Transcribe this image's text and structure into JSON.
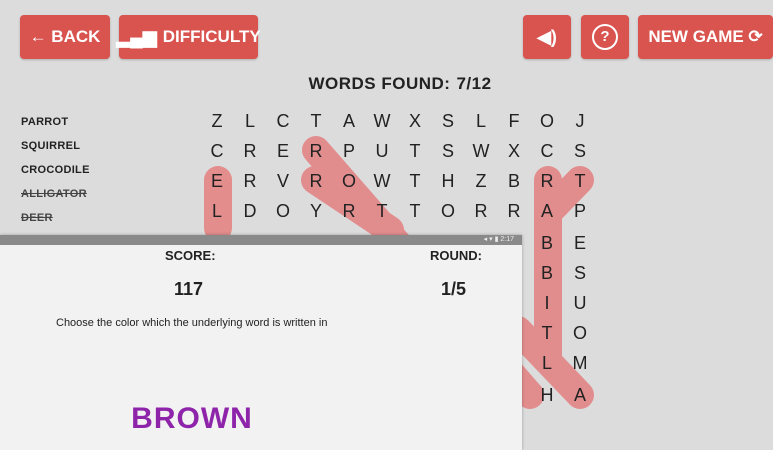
{
  "toolbar": {
    "back_label": "← BACK",
    "difficulty_label": "DIFFICULTY",
    "sound_icon": "speaker-icon",
    "help_icon": "help-circle-icon",
    "new_game_label": "NEW GAME ⟳"
  },
  "words_found": {
    "label": "WORDS FOUND:",
    "value": "7/12"
  },
  "word_list": [
    {
      "text": "PARROT",
      "found": false
    },
    {
      "text": "SQUIRREL",
      "found": false
    },
    {
      "text": "CROCODILE",
      "found": false
    },
    {
      "text": "ALLIGATOR",
      "found": true
    },
    {
      "text": "DEER",
      "found": true
    }
  ],
  "grid": {
    "rows": [
      [
        "Z",
        "L",
        "C",
        "T",
        "A",
        "W",
        "X",
        "S",
        "L",
        "F",
        "O",
        "J"
      ],
      [
        "C",
        "R",
        "E",
        "R",
        "P",
        "U",
        "T",
        "S",
        "W",
        "X",
        "C",
        "S"
      ],
      [
        "E",
        "R",
        "V",
        "R",
        "O",
        "W",
        "T",
        "H",
        "Z",
        "B",
        "R",
        "T"
      ],
      [
        "L",
        "D",
        "O",
        "Y",
        "R",
        "T",
        "T",
        "O",
        "R",
        "R",
        "A",
        "P"
      ],
      [
        "",
        "",
        "",
        "",
        "",
        "",
        "",
        "",
        "",
        "",
        "B",
        "E"
      ],
      [
        "",
        "",
        "",
        "",
        "",
        "",
        "",
        "",
        "",
        "",
        "B",
        "S"
      ],
      [
        "",
        "",
        "",
        "",
        "",
        "",
        "",
        "",
        "",
        "",
        "I",
        "U"
      ],
      [
        "",
        "",
        "",
        "",
        "",
        "",
        "",
        "",
        "",
        "",
        "T",
        "O"
      ],
      [
        "",
        "",
        "",
        "",
        "",
        "",
        "",
        "",
        "",
        "",
        "L",
        "M"
      ],
      [
        "",
        "",
        "",
        "",
        "",
        "",
        "",
        "",
        "",
        "",
        "H",
        "A"
      ]
    ],
    "highlight_color": "#e57373"
  },
  "overlay": {
    "status_time": "◂ ▾ ▮ 2:17",
    "score_label": "SCORE:",
    "score_value": "117",
    "round_label": "ROUND:",
    "round_value": "1/5",
    "instruction": "Choose the color which the underlying word is written in",
    "color_word": "BROWN",
    "color_word_color": "#8e24aa"
  }
}
